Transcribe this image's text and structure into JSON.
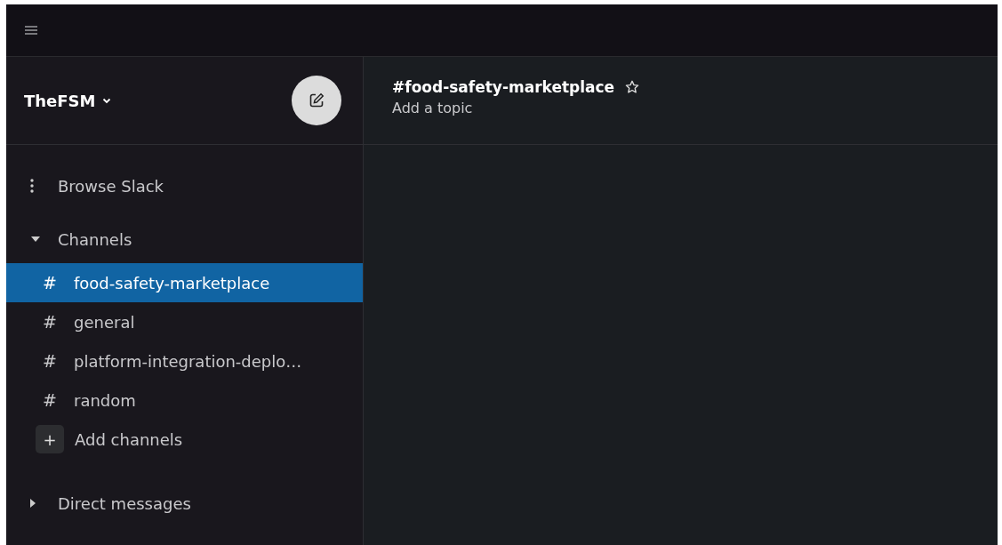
{
  "workspace": {
    "name": "TheFSM"
  },
  "browse": {
    "label": "Browse Slack"
  },
  "sections": [
    {
      "label": "Channels",
      "expanded": true,
      "items": [
        {
          "prefix": "#",
          "name": "food-safety-marketplace",
          "selected": true
        },
        {
          "prefix": "#",
          "name": "general",
          "selected": false
        },
        {
          "prefix": "#",
          "name": "platform-integration-deplo…",
          "selected": false
        },
        {
          "prefix": "#",
          "name": "random",
          "selected": false
        }
      ],
      "add": {
        "icon": "+",
        "label": "Add channels"
      }
    },
    {
      "label": "Direct messages",
      "expanded": false
    }
  ],
  "channel_header": {
    "title": "#food-safety-marketplace",
    "starred": false,
    "topic": "Add a topic"
  }
}
